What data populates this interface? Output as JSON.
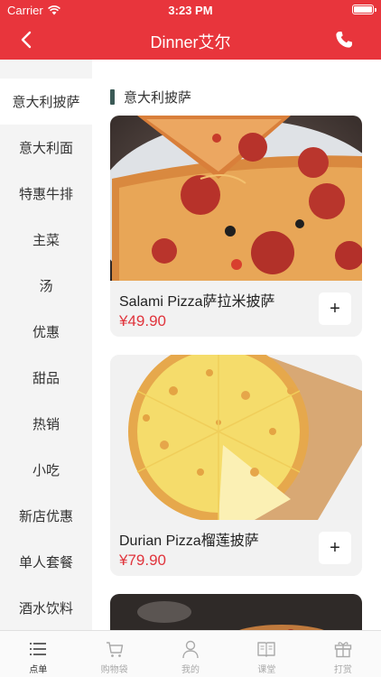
{
  "status_bar": {
    "carrier": "Carrier",
    "time": "3:23 PM"
  },
  "nav": {
    "title": "Dinner艾尔",
    "back_icon": "chevron-left-icon",
    "phone_icon": "phone-icon"
  },
  "sidebar": {
    "items": [
      {
        "label": "意大利披萨",
        "active": true
      },
      {
        "label": "意大利面"
      },
      {
        "label": "特惠牛排"
      },
      {
        "label": "主菜"
      },
      {
        "label": "汤"
      },
      {
        "label": "优惠"
      },
      {
        "label": "甜品"
      },
      {
        "label": "热销"
      },
      {
        "label": "小吃"
      },
      {
        "label": "新店优惠"
      },
      {
        "label": "单人套餐"
      },
      {
        "label": "酒水饮料"
      }
    ]
  },
  "content": {
    "section_title": "意大利披萨",
    "products": [
      {
        "name": "Salami Pizza萨拉米披萨",
        "price": "¥49.90",
        "add_label": "+"
      },
      {
        "name": "Durian Pizza榴莲披萨",
        "price": "¥79.90",
        "add_label": "+"
      }
    ]
  },
  "tab_bar": {
    "tabs": [
      {
        "label": "点单",
        "icon": "list-icon",
        "active": true
      },
      {
        "label": "购物袋",
        "icon": "cart-icon"
      },
      {
        "label": "我的",
        "icon": "person-icon"
      },
      {
        "label": "课堂",
        "icon": "book-icon"
      },
      {
        "label": "打赏",
        "icon": "gift-icon"
      }
    ]
  },
  "colors": {
    "brand_red": "#e8353c",
    "price_red": "#e0343c",
    "section_bar": "#3b5a56"
  }
}
